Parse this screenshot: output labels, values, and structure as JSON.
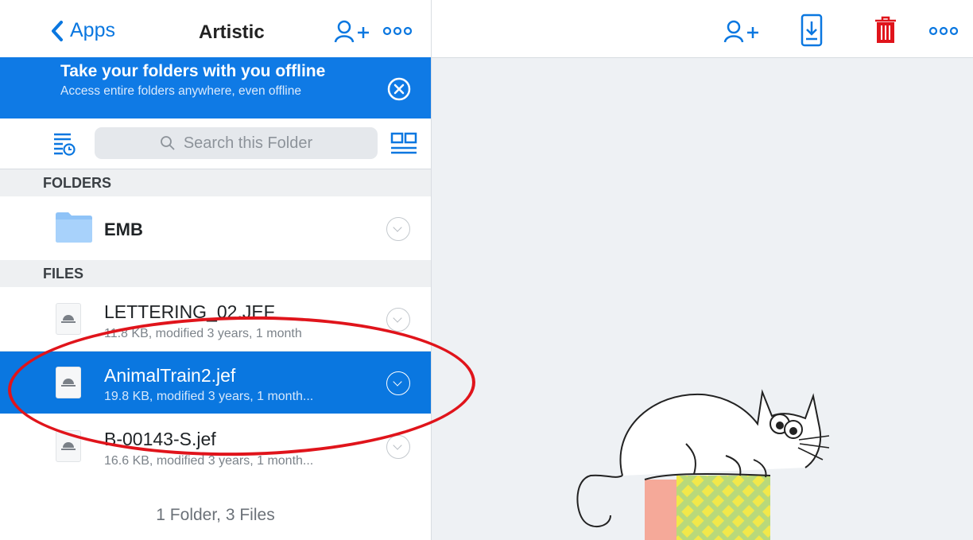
{
  "nav": {
    "back_label": "Apps",
    "title": "Artistic"
  },
  "banner": {
    "title": "Take your folders with you offline",
    "subtitle": "Access entire folders anywhere, even offline"
  },
  "search": {
    "placeholder": "Search this Folder"
  },
  "sections": {
    "folders": "FOLDERS",
    "files": "FILES"
  },
  "folders": [
    {
      "name": "EMB"
    }
  ],
  "files": [
    {
      "name": "LETTERING_02.JEF",
      "meta": "11.8 KB, modified 3 years, 1 month"
    },
    {
      "name": "AnimalTrain2.jef",
      "meta": "19.8 KB, modified 3 years, 1 month...",
      "selected": true
    },
    {
      "name": "B-00143-S.jef",
      "meta": "16.6 KB, modified 3 years, 1 month..."
    }
  ],
  "footer": "1 Folder, 3 Files",
  "colors": {
    "accent": "#0a77e0",
    "delete": "#e0141b",
    "annotation": "#e0141b"
  }
}
